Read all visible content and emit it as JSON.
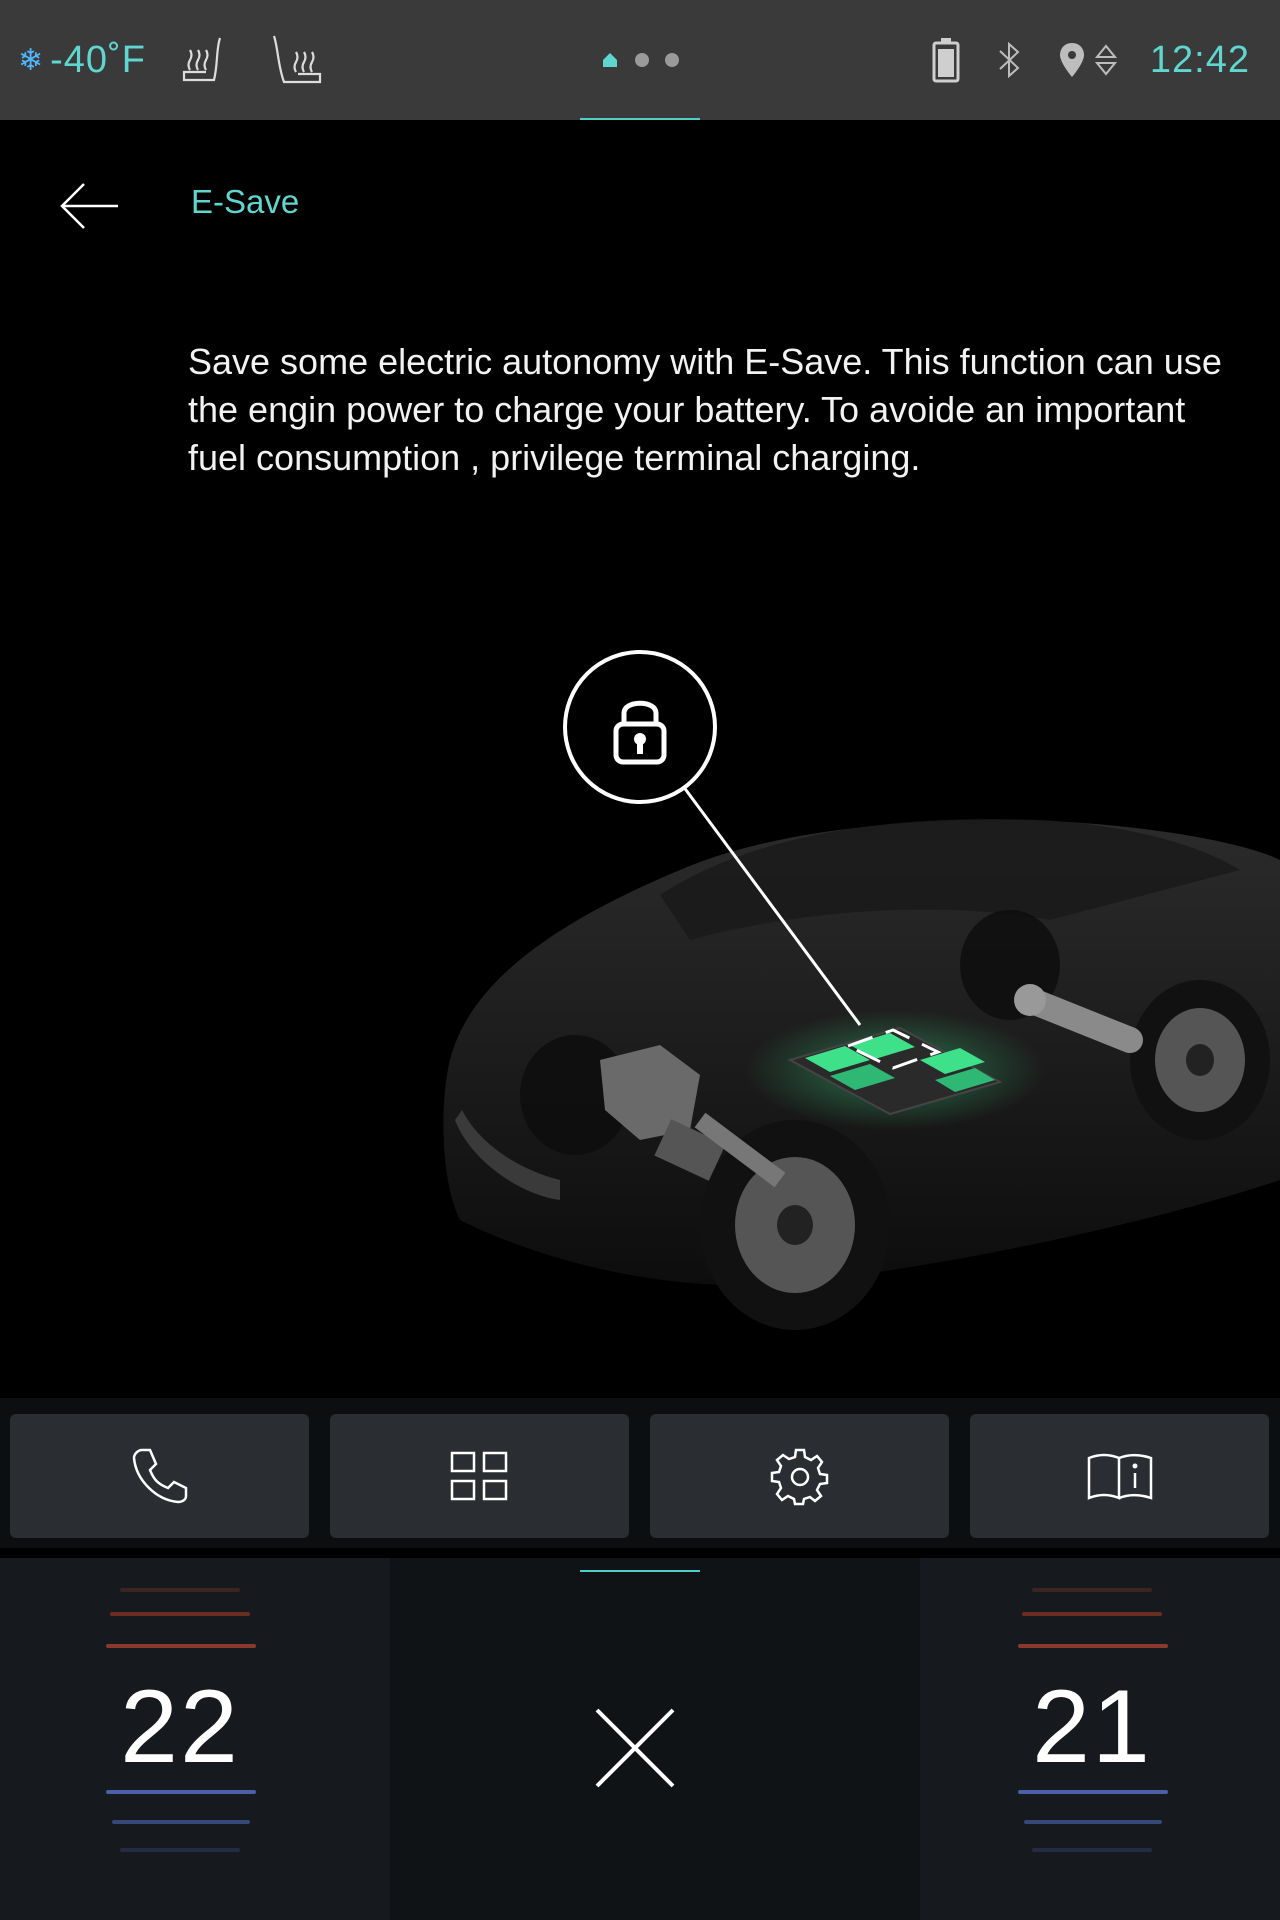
{
  "status_bar": {
    "outside_temp": "-40˚F",
    "time": "12:42",
    "icons": [
      "snowflake-icon",
      "heated-seat-icon",
      "heated-seat-icon",
      "home-icon",
      "battery-icon",
      "bluetooth-icon",
      "location-icon",
      "signal-icon"
    ]
  },
  "header": {
    "title": "E-Save"
  },
  "description": "Save some electric autonomy with E-Save. This function can use the engin power to charge your battery. To avoide an important fuel consumption , privilege terminal charging.",
  "shortcuts": [
    "phone-icon",
    "apps-grid-icon",
    "gear-icon",
    "manual-icon"
  ],
  "climate": {
    "left_temp": "22",
    "right_temp": "21"
  },
  "colors": {
    "accent": "#5fd6cf",
    "status_bar_bg": "#3a3a3a",
    "button_bg": "#2a2e32",
    "battery_green": "#3ee08a",
    "heat_red": "#8a3a2c",
    "cool_blue": "#4a5fa8"
  }
}
